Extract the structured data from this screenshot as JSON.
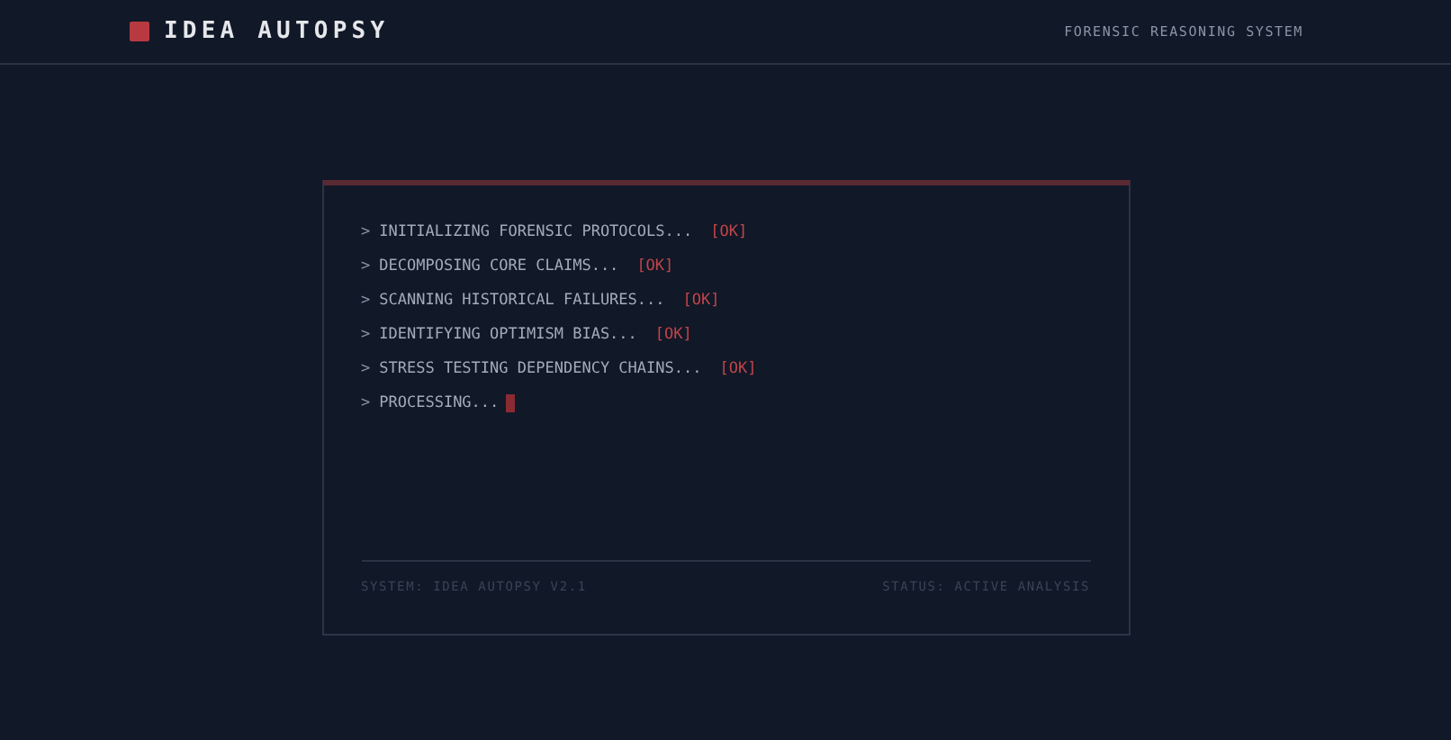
{
  "header": {
    "title": "IDEA AUTOPSY",
    "subtitle": "FORENSIC REASONING SYSTEM"
  },
  "terminal": {
    "lines": [
      {
        "prompt": ">",
        "text": "INITIALIZING FORENSIC PROTOCOLS...",
        "status": "[OK]",
        "cursor": false
      },
      {
        "prompt": ">",
        "text": "DECOMPOSING CORE CLAIMS...",
        "status": "[OK]",
        "cursor": false
      },
      {
        "prompt": ">",
        "text": "SCANNING HISTORICAL FAILURES...",
        "status": "[OK]",
        "cursor": false
      },
      {
        "prompt": ">",
        "text": "IDENTIFYING OPTIMISM BIAS...",
        "status": "[OK]",
        "cursor": false
      },
      {
        "prompt": ">",
        "text": "STRESS TESTING DEPENDENCY CHAINS...",
        "status": "[OK]",
        "cursor": false
      },
      {
        "prompt": ">",
        "text": "PROCESSING...",
        "cursor": true
      }
    ],
    "footer": {
      "system": "SYSTEM: IDEA AUTOPSY V2.1",
      "status": "STATUS: ACTIVE ANALYSIS"
    }
  }
}
